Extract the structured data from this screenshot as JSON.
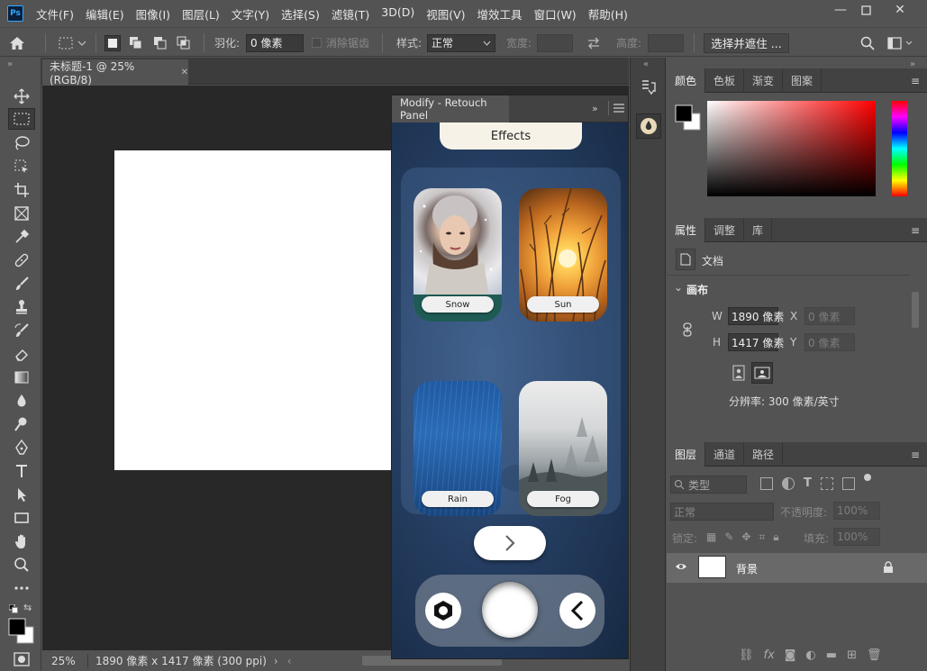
{
  "app": {
    "logo": "Ps"
  },
  "menu": [
    "文件(F)",
    "编辑(E)",
    "图像(I)",
    "图层(L)",
    "文字(Y)",
    "选择(S)",
    "滤镜(T)",
    "3D(D)",
    "视图(V)",
    "增效工具",
    "窗口(W)",
    "帮助(H)"
  ],
  "options": {
    "feather_label": "羽化:",
    "feather_value": "0 像素",
    "antialias_label": "消除锯齿",
    "style_label": "样式:",
    "style_value": "正常",
    "width_label": "宽度:",
    "height_label": "高度:",
    "select_mask_button": "选择并遮住 ..."
  },
  "document": {
    "tab_title": "未标题-1 @ 25%(RGB/8)",
    "zoom": "25%",
    "info": "1890 像素 x 1417 像素 (300 ppi)"
  },
  "plugin": {
    "tab_title": "Modify - Retouch Panel",
    "section_title": "Effects",
    "effects": [
      "Snow",
      "Sun",
      "Rain",
      "Fog"
    ]
  },
  "color_panel": {
    "tabs": [
      "颜色",
      "色板",
      "渐变",
      "图案"
    ]
  },
  "properties_panel": {
    "tabs": [
      "属性",
      "调整",
      "库"
    ],
    "doc_label": "文档",
    "section": "画布",
    "w_label": "W",
    "w_value": "1890 像素",
    "h_label": "H",
    "h_value": "1417 像素",
    "x_label": "X",
    "x_value": "0 像素",
    "y_label": "Y",
    "y_value": "0 像素",
    "resolution": "分辨率: 300 像素/英寸"
  },
  "layers_panel": {
    "tabs": [
      "图层",
      "通道",
      "路径"
    ],
    "filter_kind": "类型",
    "blend_mode": "正常",
    "opacity_label": "不透明度:",
    "opacity_value": "100%",
    "lock_label": "锁定:",
    "fill_label": "填充:",
    "fill_value": "100%",
    "layer_name": "背景"
  },
  "colors": {
    "accent": "#31a8ff",
    "panel_bg": "#535353",
    "canvas_bg": "#282828"
  }
}
